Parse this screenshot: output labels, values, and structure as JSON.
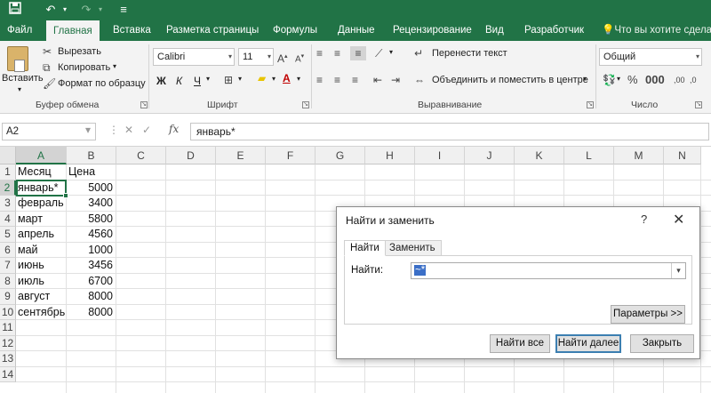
{
  "colors": {
    "brand": "#217346",
    "ribbon_bg": "#f3f3f3",
    "selection": "#217346",
    "highlight": "#3b6fc7"
  },
  "qat": {
    "icons": [
      "save-icon",
      "undo-icon",
      "redo-icon",
      "customize-icon"
    ]
  },
  "tabs": [
    {
      "label": "Файл",
      "active": false
    },
    {
      "label": "Главная",
      "active": true
    },
    {
      "label": "Вставка",
      "active": false
    },
    {
      "label": "Разметка страницы",
      "active": false
    },
    {
      "label": "Формулы",
      "active": false
    },
    {
      "label": "Данные",
      "active": false
    },
    {
      "label": "Рецензирование",
      "active": false
    },
    {
      "label": "Вид",
      "active": false
    },
    {
      "label": "Разработчик",
      "active": false
    }
  ],
  "tellme": "Что вы хотите сделать?",
  "ribbon": {
    "clipboard": {
      "paste": "Вставить",
      "cut": "Вырезать",
      "copy": "Копировать",
      "format_painter": "Формат по образцу",
      "label": "Буфер обмена"
    },
    "font": {
      "name": "Calibri",
      "size": "11",
      "bold": "Ж",
      "italic": "К",
      "underline": "Ч",
      "label": "Шрифт"
    },
    "alignment": {
      "wrap_text": "Перенести текст",
      "merge_center": "Объединить и поместить в центре",
      "label": "Выравнивание"
    },
    "number": {
      "format": "Общий",
      "label": "Число"
    }
  },
  "formula_bar": {
    "name_box": "A2",
    "fx": "fx",
    "content": "январь*"
  },
  "sheet": {
    "columns": [
      "A",
      "B",
      "C",
      "D",
      "E",
      "F",
      "G",
      "H",
      "I",
      "J",
      "K",
      "L",
      "M",
      "N"
    ],
    "rows": [
      "1",
      "2",
      "3",
      "4",
      "5",
      "6",
      "7",
      "8",
      "9",
      "10",
      "11",
      "12",
      "13",
      "14"
    ],
    "header_a": "Месяц",
    "header_b": "Цена",
    "data": [
      {
        "month": "январь*",
        "price": "5000"
      },
      {
        "month": "февраль",
        "price": "3400"
      },
      {
        "month": "март",
        "price": "5800"
      },
      {
        "month": "апрель",
        "price": "4560"
      },
      {
        "month": "май",
        "price": "1000"
      },
      {
        "month": "июнь",
        "price": "3456"
      },
      {
        "month": "июль",
        "price": "6700"
      },
      {
        "month": "август",
        "price": "8000"
      },
      {
        "month": "сентябрь",
        "price": "8000"
      }
    ]
  },
  "dialog": {
    "title": "Найти и заменить",
    "help": "?",
    "close": "✕",
    "tab_find": "Найти",
    "tab_replace": "Заменить",
    "find_label": "Найти:",
    "find_value": "~*",
    "options_button": "Параметры >>",
    "find_all": "Найти все",
    "find_next": "Найти далее",
    "close_button": "Закрыть"
  }
}
